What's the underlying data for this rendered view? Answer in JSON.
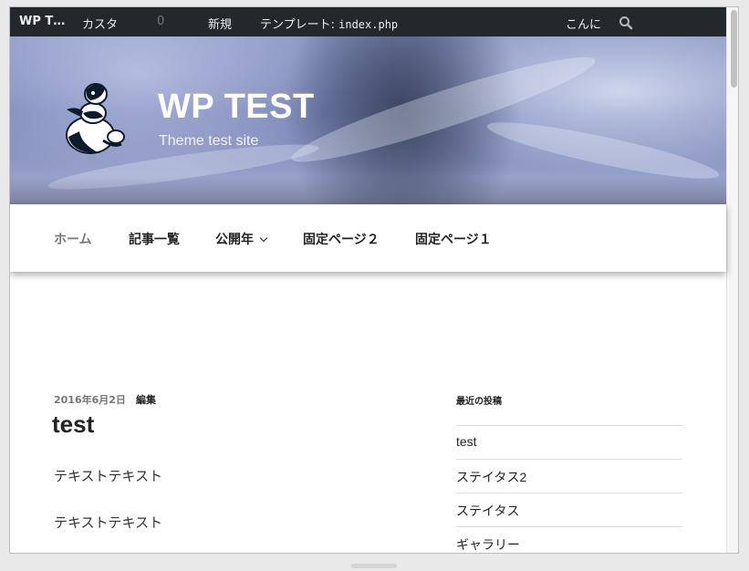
{
  "adminbar": {
    "site_name": "WP T…",
    "customize": "カスタ",
    "comment_count": "0",
    "new": "新規",
    "template_label": "テンプレート: ",
    "template_file": "index.php",
    "howdy": "こんに"
  },
  "header": {
    "site_title": "WP TEST",
    "site_description": "Theme test site"
  },
  "nav": {
    "items": [
      {
        "label": "ホーム",
        "active": true
      },
      {
        "label": "記事一覧"
      },
      {
        "label": "公開年",
        "has_submenu": true
      },
      {
        "label": "固定ページ２"
      },
      {
        "label": "固定ページ１"
      }
    ]
  },
  "post": {
    "date": "2016年6月2日",
    "edit_label": "編集",
    "title": "test",
    "paragraphs": [
      "テキストテキスト",
      "テキストテキスト"
    ]
  },
  "sidebar": {
    "widget_title": "最近の投稿",
    "recent_posts": [
      "test",
      "ステイタス2",
      "ステイタス",
      "ギャラリー"
    ]
  },
  "colors": {
    "adminbar_bg": "#23282d",
    "nav_active": "#767676",
    "text": "#222222"
  },
  "icons": {
    "search": "search-icon",
    "logo": "snowman-logo-icon",
    "submenu": "chevron-down-icon"
  }
}
